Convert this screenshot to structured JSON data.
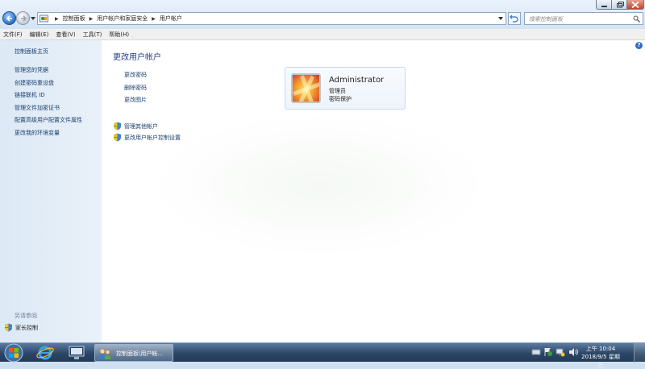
{
  "window": {
    "breadcrumbs": [
      "控制面板",
      "用户帐户和家庭安全",
      "用户帐户"
    ],
    "search_placeholder": "搜索控制面板"
  },
  "menu": [
    "文件(F)",
    "编辑(E)",
    "查看(V)",
    "工具(T)",
    "帮助(H)"
  ],
  "leftnav": {
    "home": "控制面板主页",
    "links": [
      "管理您的凭据",
      "创建密码重设盘",
      "链接联机 ID",
      "管理文件加密证书",
      "配置高级用户配置文件属性",
      "更改我的环境变量"
    ],
    "see_also": "另请参阅",
    "family": "家长控制"
  },
  "main": {
    "title": "更改用户帐户",
    "tasks": [
      "更改密码",
      "删除密码",
      "更改图片"
    ],
    "shield_tasks": [
      "管理其他帐户",
      "更改用户帐户控制设置"
    ],
    "account": {
      "name": "Administrator",
      "role": "管理员",
      "status": "密码保护"
    }
  },
  "taskbar": {
    "active_task": "控制面板\\用户帐...",
    "time": "上午 10:04",
    "date": "2018/9/5 星期三"
  },
  "colors": {
    "link": "#1a3d6e",
    "title": "#1e3f86",
    "taskbar": "#2c4666"
  }
}
